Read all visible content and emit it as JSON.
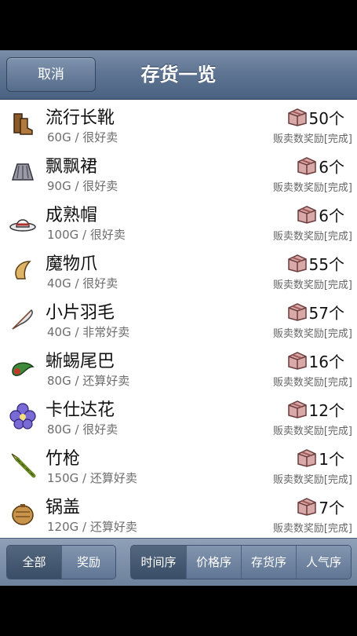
{
  "header": {
    "cancel_label": "取消",
    "title": "存货一览"
  },
  "items": [
    {
      "name": "流行长靴",
      "price_popularity": "60G / 很好卖",
      "count": "50个",
      "bonus": "贩卖数奖励[完成]",
      "icon": "boots-icon"
    },
    {
      "name": "飘飘裙",
      "price_popularity": "90G / 很好卖",
      "count": "6个",
      "bonus": "贩卖数奖励[完成]",
      "icon": "skirt-icon"
    },
    {
      "name": "成熟帽",
      "price_popularity": "100G / 很好卖",
      "count": "6个",
      "bonus": "贩卖数奖励[完成]",
      "icon": "hat-icon"
    },
    {
      "name": "魔物爪",
      "price_popularity": "40G / 很好卖",
      "count": "55个",
      "bonus": "贩卖数奖励[完成]",
      "icon": "claw-icon"
    },
    {
      "name": "小片羽毛",
      "price_popularity": "40G / 非常好卖",
      "count": "57个",
      "bonus": "贩卖数奖励[完成]",
      "icon": "feather-icon"
    },
    {
      "name": "蜥蜴尾巴",
      "price_popularity": "80G / 还算好卖",
      "count": "16个",
      "bonus": "贩卖数奖励[完成]",
      "icon": "lizard-tail-icon"
    },
    {
      "name": "卡仕达花",
      "price_popularity": "80G / 很好卖",
      "count": "12个",
      "bonus": "贩卖数奖励[完成]",
      "icon": "flower-icon"
    },
    {
      "name": "竹枪",
      "price_popularity": "150G / 还算好卖",
      "count": "1个",
      "bonus": "贩卖数奖励[完成]",
      "icon": "bamboo-spear-icon"
    },
    {
      "name": "锅盖",
      "price_popularity": "120G / 还算好卖",
      "count": "7个",
      "bonus": "贩卖数奖励[完成]",
      "icon": "pot-lid-icon"
    }
  ],
  "footer": {
    "filter": [
      "全部",
      "奖励"
    ],
    "sort": [
      "时间序",
      "价格序",
      "存货序",
      "人气序"
    ]
  }
}
